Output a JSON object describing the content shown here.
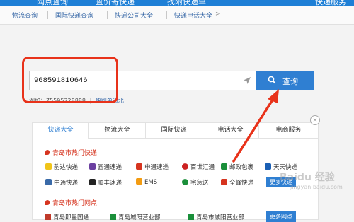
{
  "top_nav": {
    "items": [
      "网点查询",
      "查价寄快递",
      "找附快递单",
      "快递服务"
    ]
  },
  "sub_nav": {
    "items": [
      "物流查询",
      "国际快递查询",
      "快递公司大全",
      "快递电话大全",
      ">"
    ]
  },
  "search": {
    "value": "968591810646",
    "button_label": "查询"
  },
  "example": {
    "prefix": "例如：75595228888",
    "link": "快刷单追北"
  },
  "panel": {
    "close": "×",
    "tabs": [
      "快递大全",
      "物流大全",
      "国际快递",
      "电话大全",
      "电商服务"
    ],
    "section_carriers": "青岛市热门快递",
    "carriers_row1": [
      "韵达快递",
      "圆通速递",
      "申通速递",
      "百世汇通",
      "邮政包裹",
      "天天快递"
    ],
    "carriers_row2": [
      "中通快递",
      "顺丰速递",
      "EMS",
      "宅急送",
      "全峰快递"
    ],
    "more_carriers": "更多快递",
    "section_points": "青岛市热门网点",
    "points": [
      "青岛即墨国通",
      "青岛城阳营业部",
      "青岛市城阳营业部"
    ],
    "more_points": "更多网点"
  },
  "watermark": {
    "line1": "Baidu 经验",
    "line2": "jingyan.baidu.com"
  },
  "colors": {
    "primary": "#2f7fd2",
    "annotation_red": "#e8321a"
  }
}
